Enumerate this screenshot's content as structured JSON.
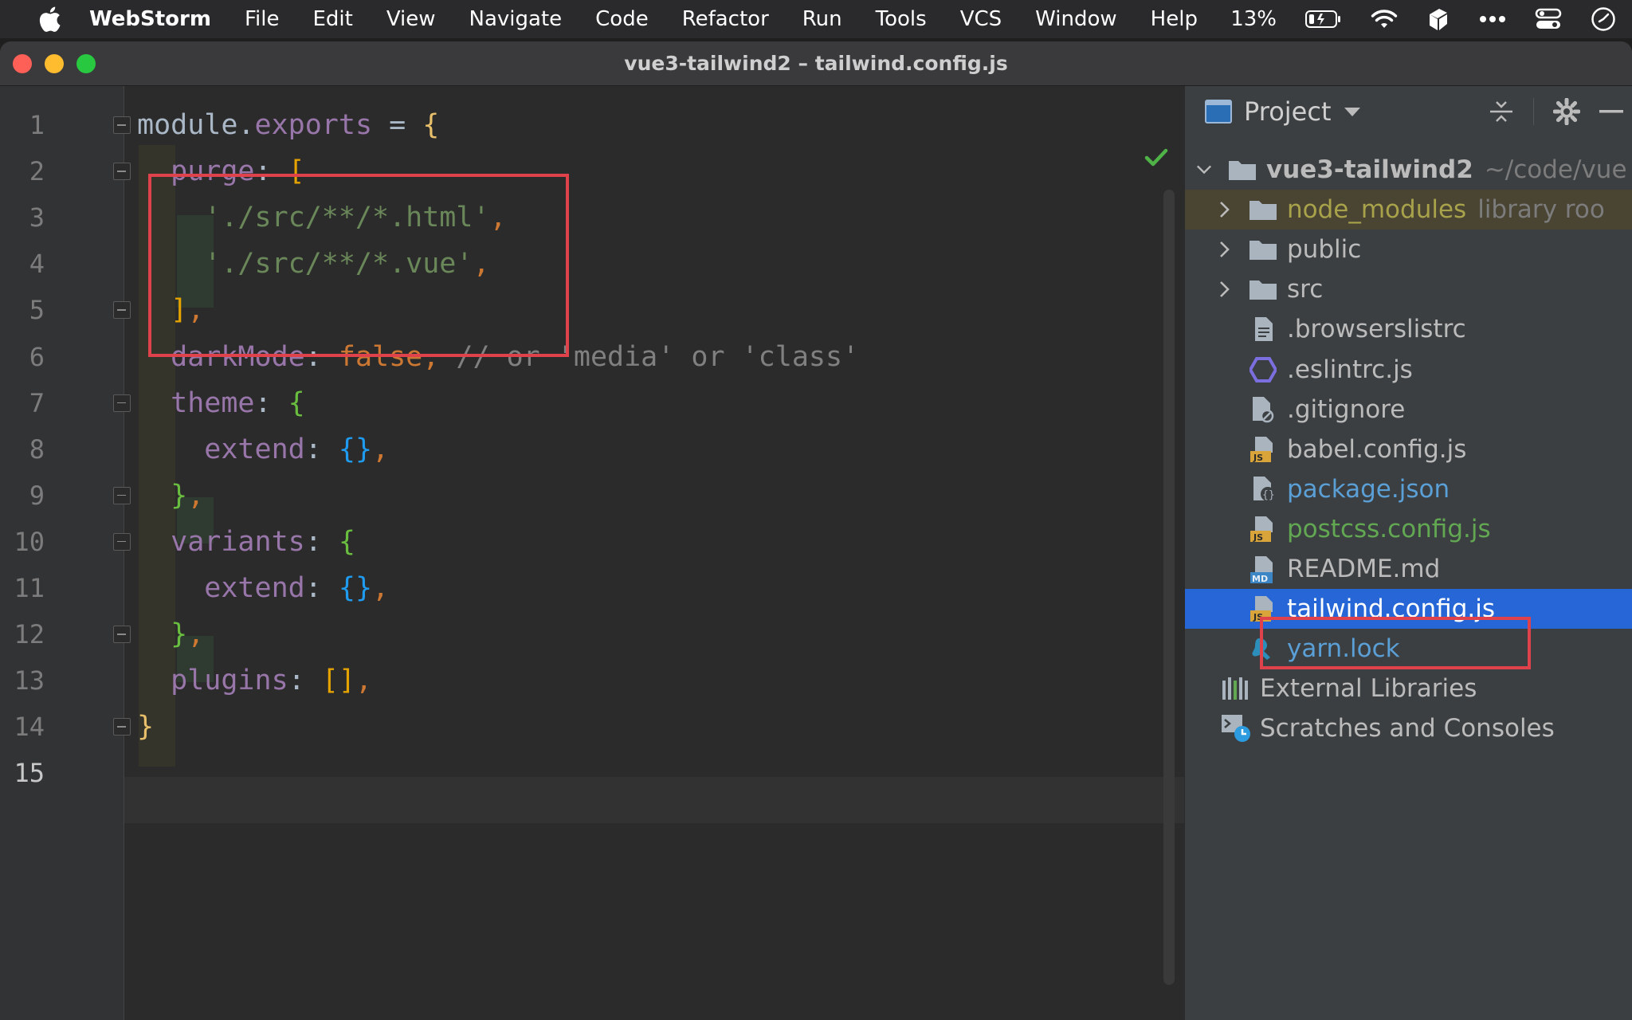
{
  "menubar": {
    "app_name": "WebStorm",
    "items": [
      "File",
      "Edit",
      "View",
      "Navigate",
      "Code",
      "Refactor",
      "Run",
      "Tools",
      "VCS",
      "Window",
      "Help"
    ],
    "battery": "13%"
  },
  "window": {
    "title": "vue3-tailwind2 – tailwind.config.js"
  },
  "editor": {
    "line_numbers": [
      "1",
      "2",
      "3",
      "4",
      "5",
      "6",
      "7",
      "8",
      "9",
      "10",
      "11",
      "12",
      "13",
      "14",
      "15"
    ],
    "current_line": "15",
    "lines": [
      [
        {
          "t": "module.",
          "c": "plain"
        },
        {
          "t": "exports",
          "c": "prop"
        },
        {
          "t": " = ",
          "c": "plain"
        },
        {
          "t": "{",
          "c": "brace"
        }
      ],
      [
        {
          "t": "  purge",
          "c": "prop"
        },
        {
          "t": ": ",
          "c": "plain"
        },
        {
          "t": "[",
          "c": "brk"
        }
      ],
      [
        {
          "t": "    './src/**/*.html'",
          "c": "str"
        },
        {
          "t": ",",
          "c": "punct"
        }
      ],
      [
        {
          "t": "    './src/**/*.vue'",
          "c": "str"
        },
        {
          "t": ",",
          "c": "punct"
        }
      ],
      [
        {
          "t": "  ]",
          "c": "brk"
        },
        {
          "t": ",",
          "c": "punct"
        }
      ],
      [
        {
          "t": "  darkMode",
          "c": "prop"
        },
        {
          "t": ": ",
          "c": "plain"
        },
        {
          "t": "false",
          "c": "kw"
        },
        {
          "t": ", ",
          "c": "punct"
        },
        {
          "t": "// or 'media' or 'class'",
          "c": "cmt"
        }
      ],
      [
        {
          "t": "  theme",
          "c": "prop"
        },
        {
          "t": ": ",
          "c": "plain"
        },
        {
          "t": "{",
          "c": "green"
        }
      ],
      [
        {
          "t": "    extend",
          "c": "prop"
        },
        {
          "t": ": ",
          "c": "plain"
        },
        {
          "t": "{}",
          "c": "blue"
        },
        {
          "t": ",",
          "c": "punct"
        }
      ],
      [
        {
          "t": "  }",
          "c": "green"
        },
        {
          "t": ",",
          "c": "punct"
        }
      ],
      [
        {
          "t": "  variants",
          "c": "prop"
        },
        {
          "t": ": ",
          "c": "plain"
        },
        {
          "t": "{",
          "c": "green"
        }
      ],
      [
        {
          "t": "    extend",
          "c": "prop"
        },
        {
          "t": ": ",
          "c": "plain"
        },
        {
          "t": "{}",
          "c": "blue"
        },
        {
          "t": ",",
          "c": "punct"
        }
      ],
      [
        {
          "t": "  }",
          "c": "green"
        },
        {
          "t": ",",
          "c": "punct"
        }
      ],
      [
        {
          "t": "  plugins",
          "c": "prop"
        },
        {
          "t": ": ",
          "c": "plain"
        },
        {
          "t": "[]",
          "c": "brk"
        },
        {
          "t": ",",
          "c": "punct"
        }
      ],
      [
        {
          "t": "}",
          "c": "brace"
        }
      ],
      []
    ]
  },
  "project_panel": {
    "title": "Project",
    "tree": [
      {
        "name": "vue3-tailwind2",
        "hint": "~/code/vue",
        "type": "folder",
        "expanded": true,
        "level": 0,
        "bold": true
      },
      {
        "name": "node_modules",
        "hint": "library roo",
        "type": "folder",
        "collapsed": true,
        "level": 1,
        "style": "excluded"
      },
      {
        "name": "public",
        "type": "folder",
        "collapsed": true,
        "level": 1
      },
      {
        "name": "src",
        "type": "folder",
        "collapsed": true,
        "level": 1
      },
      {
        "name": ".browserslistrc",
        "type": "file",
        "level": 1
      },
      {
        "name": ".eslintrc.js",
        "type": "eslint",
        "level": 1
      },
      {
        "name": ".gitignore",
        "type": "ignore",
        "level": 1
      },
      {
        "name": "babel.config.js",
        "type": "js",
        "level": 1
      },
      {
        "name": "package.json",
        "type": "json",
        "level": 1,
        "style": "modified"
      },
      {
        "name": "postcss.config.js",
        "type": "js",
        "level": 1,
        "style": "added"
      },
      {
        "name": "README.md",
        "type": "md",
        "level": 1
      },
      {
        "name": "tailwind.config.js",
        "type": "js",
        "level": 1,
        "style": "selected"
      },
      {
        "name": "yarn.lock",
        "type": "yarn",
        "level": 1,
        "style": "modified"
      },
      {
        "name": "External Libraries",
        "type": "libs",
        "level": 0
      },
      {
        "name": "Scratches and Consoles",
        "type": "scratch",
        "level": 0
      }
    ]
  },
  "colors": {
    "highlight_box": "#e0424c",
    "selection": "#2766d6",
    "editor_bg": "#2b2b2b",
    "panel_bg": "#3c3f41"
  }
}
